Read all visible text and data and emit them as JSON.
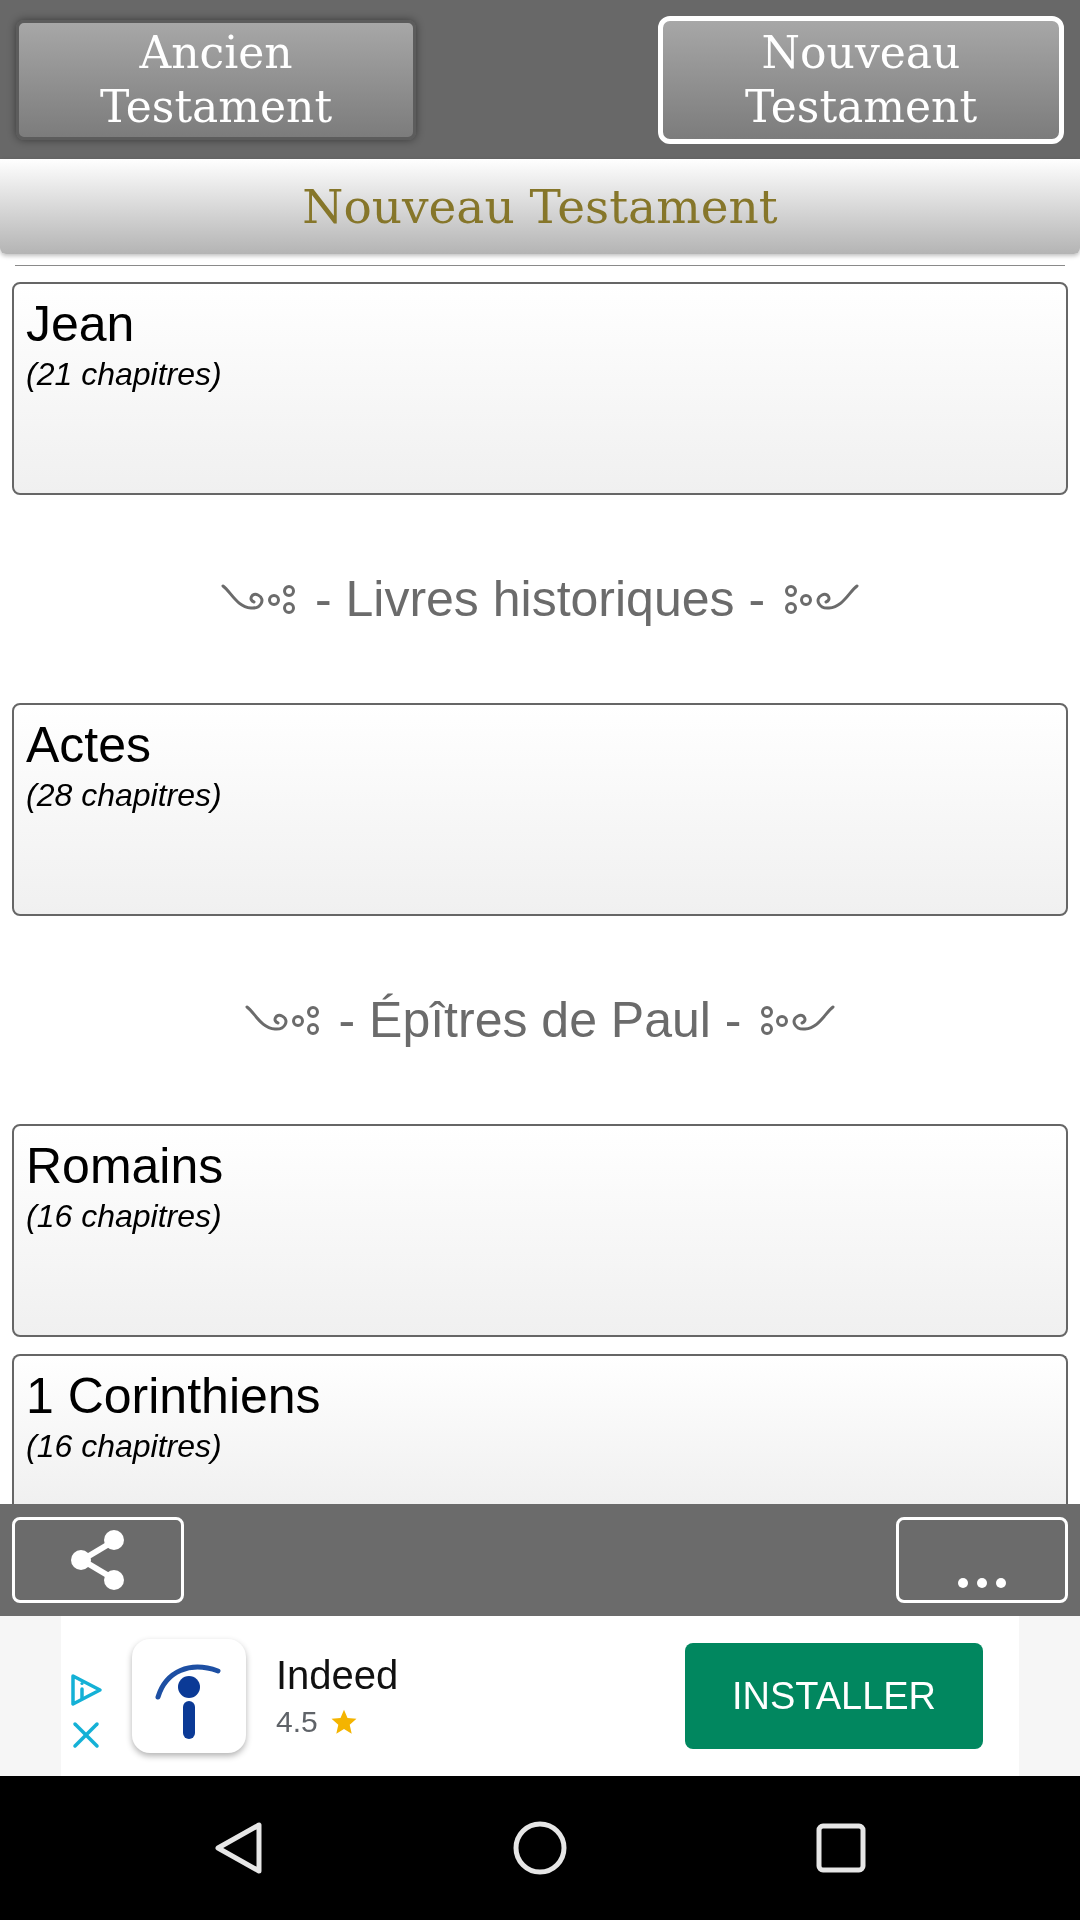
{
  "testament_tabs": [
    {
      "label": "Ancien Testament",
      "selected": false
    },
    {
      "label": "Nouveau Testament",
      "selected": true
    }
  ],
  "section_title": "Nouveau Testament",
  "items": [
    {
      "kind": "book",
      "title": "Jean",
      "subtitle": "(21 chapitres)"
    },
    {
      "kind": "divider",
      "label": "- Livres historiques -"
    },
    {
      "kind": "book",
      "title": "Actes",
      "subtitle": "(28 chapitres)"
    },
    {
      "kind": "divider",
      "label": "- Épîtres de Paul -"
    },
    {
      "kind": "book",
      "title": "Romains",
      "subtitle": "(16 chapitres)"
    },
    {
      "kind": "book",
      "title": "1 Corinthiens",
      "subtitle": "(16 chapitres)"
    }
  ],
  "ad": {
    "app_name": "Indeed",
    "rating": "4.5",
    "button": "INSTALLER"
  }
}
